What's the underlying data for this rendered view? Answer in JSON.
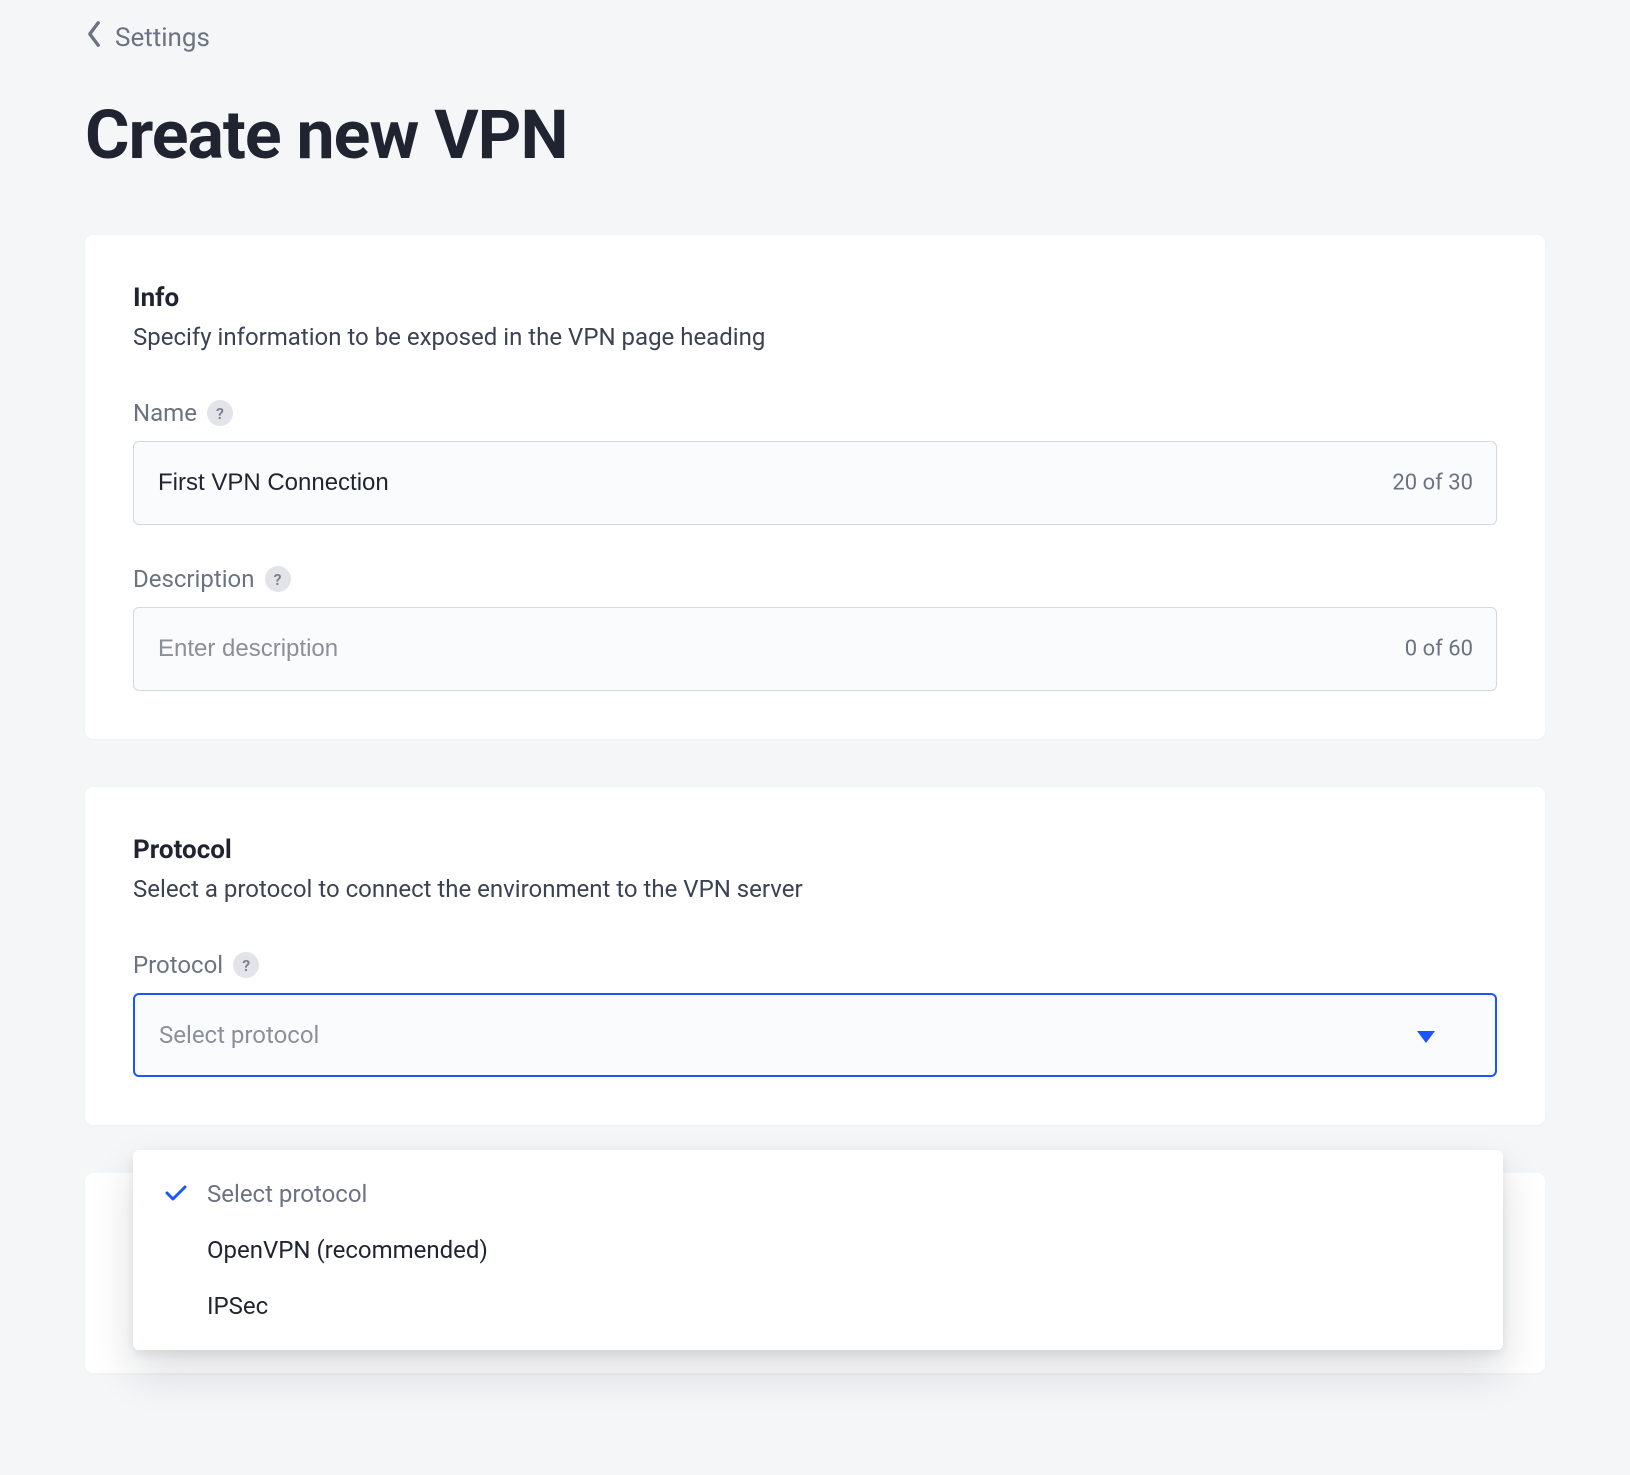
{
  "breadcrumb": {
    "label": "Settings"
  },
  "page": {
    "title": "Create new VPN"
  },
  "sections": {
    "info": {
      "title": "Info",
      "subtitle": "Specify information to be exposed in the VPN page heading",
      "name": {
        "label": "Name",
        "value": "First VPN Connection",
        "counter": "20 of 30"
      },
      "description": {
        "label": "Description",
        "placeholder": "Enter description",
        "value": "",
        "counter": "0 of 60"
      }
    },
    "protocol": {
      "title": "Protocol",
      "subtitle": "Select a protocol to connect the environment to the VPN server",
      "label": "Protocol",
      "placeholder": "Select protocol",
      "options": [
        {
          "label": "Select protocol",
          "selected": true,
          "placeholder": true
        },
        {
          "label": "OpenVPN (recommended)",
          "selected": false
        },
        {
          "label": "IPSec",
          "selected": false
        }
      ]
    }
  },
  "icons": {
    "help": "?",
    "chevron_left": "chevron-left",
    "caret_down": "caret-down",
    "check": "check"
  },
  "colors": {
    "accent": "#1a55ff",
    "background": "#f5f6f8",
    "card": "#ffffff",
    "text_muted": "#6b7280"
  }
}
